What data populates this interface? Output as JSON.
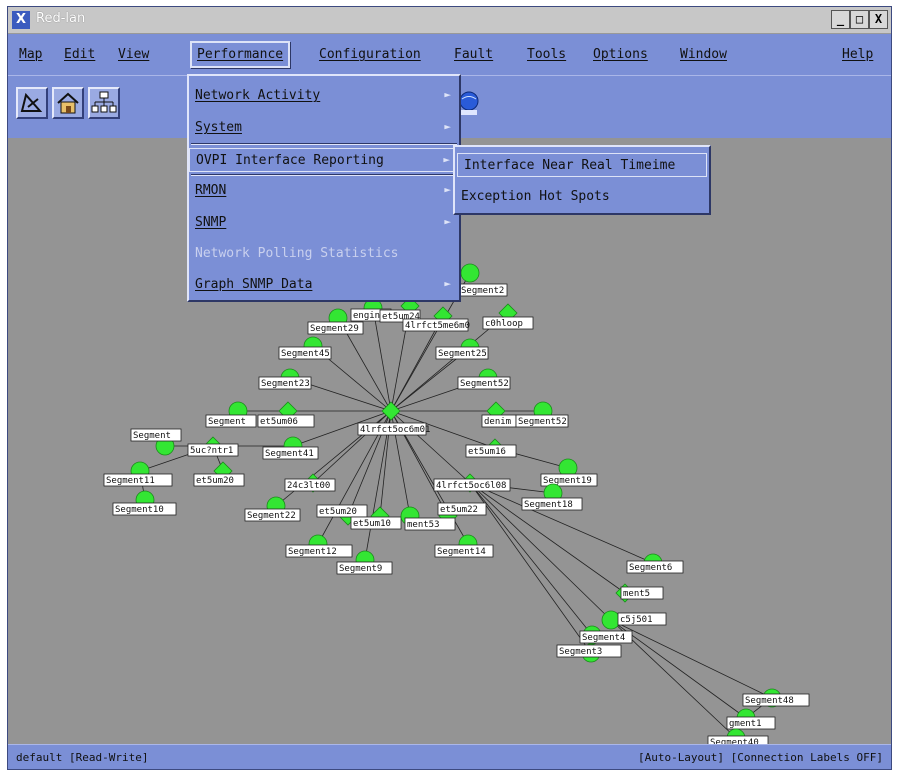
{
  "window": {
    "title": "Red-lan",
    "app_icon": "X",
    "minimize": "_",
    "maximize": "□",
    "close": "X"
  },
  "menubar": [
    "Map",
    "Edit",
    "View",
    "Performance",
    "Configuration",
    "Fault",
    "Tools",
    "Options",
    "Window",
    "Help"
  ],
  "performance_menu": [
    {
      "label": "Network Activity",
      "submenu": true
    },
    {
      "label": "System",
      "submenu": true
    },
    {
      "label": "OVPI Interface Reporting",
      "submenu": true,
      "active": true
    },
    {
      "label": "RMON",
      "submenu": true
    },
    {
      "label": "SNMP",
      "submenu": true
    },
    {
      "label": "Network Polling Statistics",
      "disabled": true
    },
    {
      "label": "Graph SNMP Data",
      "submenu": true
    }
  ],
  "ovpi_submenu": [
    "Interface Near Real Timeime",
    "Exception Hot Spots"
  ],
  "toolbar_icons": [
    "map-tool-icon",
    "home-icon",
    "network-tree-icon",
    "globe-icon"
  ],
  "status": {
    "left": "default [Read-Write]",
    "right": "[Auto-Layout] [Connection Labels OFF]"
  },
  "map": {
    "nodes": [
      {
        "id": "hub",
        "label": "4lrfct5oc6m01",
        "shape": "diamond"
      },
      {
        "id": "s2",
        "label": "Segment2",
        "shape": "circle"
      },
      {
        "id": "s29",
        "label": "Segment29",
        "shape": "circle"
      },
      {
        "id": "eng",
        "label": "engineer",
        "shape": "circle"
      },
      {
        "id": "et24",
        "label": "et5um24",
        "shape": "diamond"
      },
      {
        "id": "r4",
        "label": "4lrfct5me6m0",
        "shape": "diamond"
      },
      {
        "id": "loop",
        "label": "c0hloop",
        "shape": "diamond"
      },
      {
        "id": "s45",
        "label": "Segment45",
        "shape": "circle"
      },
      {
        "id": "s25",
        "label": "Segment25",
        "shape": "circle"
      },
      {
        "id": "s23",
        "label": "Segment23",
        "shape": "circle"
      },
      {
        "id": "s52a",
        "label": "Segment52",
        "shape": "circle"
      },
      {
        "id": "seg",
        "label": "Segment",
        "shape": "circle"
      },
      {
        "id": "et06",
        "label": "et5um06",
        "shape": "diamond"
      },
      {
        "id": "denim",
        "label": "denim",
        "shape": "diamond"
      },
      {
        "id": "s52b",
        "label": "Segment52",
        "shape": "circle"
      },
      {
        "id": "seg2",
        "label": "Segment",
        "shape": "circle"
      },
      {
        "id": "a5u",
        "label": "5uc?ntr1",
        "shape": "diamond"
      },
      {
        "id": "s41",
        "label": "Segment41",
        "shape": "circle"
      },
      {
        "id": "et16",
        "label": "et5um16",
        "shape": "diamond"
      },
      {
        "id": "s11",
        "label": "Segment11",
        "shape": "circle"
      },
      {
        "id": "et20",
        "label": "et5um20",
        "shape": "diamond"
      },
      {
        "id": "s19",
        "label": "Segment19",
        "shape": "circle"
      },
      {
        "id": "s10",
        "label": "Segment10",
        "shape": "circle"
      },
      {
        "id": "h24",
        "label": "24c3lt00",
        "shape": "diamond"
      },
      {
        "id": "r08",
        "label": "4lrfct5oc6l08",
        "shape": "diamond"
      },
      {
        "id": "s18",
        "label": "Segment18",
        "shape": "circle"
      },
      {
        "id": "s22",
        "label": "Segment22",
        "shape": "circle"
      },
      {
        "id": "et20b",
        "label": "et5um20",
        "shape": "diamond"
      },
      {
        "id": "et22",
        "label": "et5um22",
        "shape": "diamond"
      },
      {
        "id": "et10",
        "label": "et5um10",
        "shape": "diamond"
      },
      {
        "id": "s53",
        "label": "ment53",
        "shape": "circle"
      },
      {
        "id": "s12",
        "label": "Segment12",
        "shape": "circle"
      },
      {
        "id": "s14",
        "label": "Segment14",
        "shape": "circle"
      },
      {
        "id": "s9",
        "label": "Segment9",
        "shape": "circle"
      },
      {
        "id": "s6",
        "label": "Segment6",
        "shape": "circle"
      },
      {
        "id": "s5",
        "label": "ment5",
        "shape": "diamond"
      },
      {
        "id": "c5j",
        "label": "c5j501",
        "shape": "circle"
      },
      {
        "id": "s4",
        "label": "Segment4",
        "shape": "circle"
      },
      {
        "id": "s3",
        "label": "Segment3",
        "shape": "circle"
      },
      {
        "id": "s48",
        "label": "Segment48",
        "shape": "circle"
      },
      {
        "id": "s1",
        "label": "gment1",
        "shape": "circle"
      },
      {
        "id": "s40",
        "label": "Segment40",
        "shape": "circle"
      }
    ]
  }
}
